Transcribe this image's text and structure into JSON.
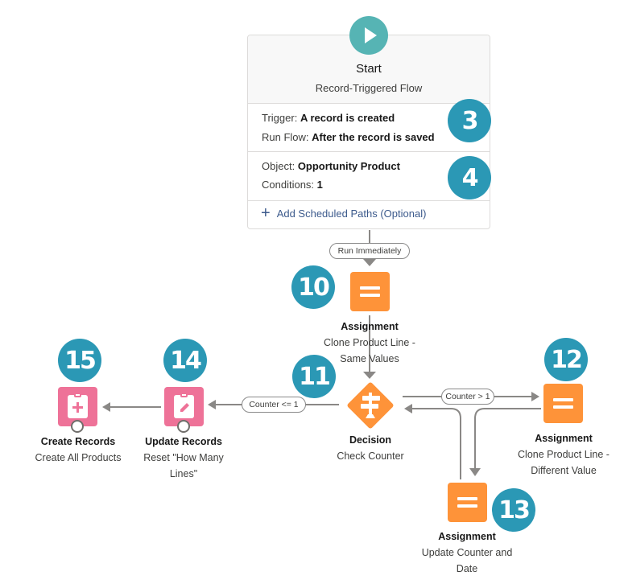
{
  "start": {
    "icon": "play-icon",
    "title": "Start",
    "subtitle": "Record-Triggered Flow",
    "trigger_label": "Trigger:",
    "trigger_value": "A record is created",
    "run_flow_label": "Run Flow:",
    "run_flow_value": "After the record is saved",
    "object_label": "Object:",
    "object_value": "Opportunity Product",
    "conditions_label": "Conditions:",
    "conditions_value": "1",
    "add_paths_label": "Add Scheduled Paths (Optional)"
  },
  "badges": {
    "b3": "3",
    "b4": "4",
    "b10": "10",
    "b11": "11",
    "b12": "12",
    "b13": "13",
    "b14": "14",
    "b15": "15"
  },
  "connectors": {
    "run_immediately": "Run Immediately",
    "counter_le_1": "Counter <= 1",
    "counter_gt_1": "Counter > 1"
  },
  "nodes": {
    "assign_same": {
      "type": "Assignment",
      "name_line1": "Clone Product Line -",
      "name_line2": "Same Values",
      "icon": "equals-icon"
    },
    "decision": {
      "type": "Decision",
      "name": "Check Counter",
      "icon": "signpost-icon"
    },
    "assign_diff": {
      "type": "Assignment",
      "name_line1": "Clone Product Line -",
      "name_line2": "Different Value",
      "icon": "equals-icon"
    },
    "assign_counter": {
      "type": "Assignment",
      "name_line1": "Update Counter and",
      "name_line2": "Date",
      "icon": "equals-icon"
    },
    "update_records": {
      "type": "Update Records",
      "name_line1": "Reset \"How Many",
      "name_line2": "Lines\"",
      "icon": "clipboard-edit-icon"
    },
    "create_records": {
      "type": "Create Records",
      "name": "Create All Products",
      "icon": "clipboard-add-icon"
    }
  },
  "colors": {
    "badge": "#2b98b5",
    "start": "#56b4b4",
    "assignment": "#fe9339",
    "records": "#ee7298",
    "connector": "#8a8886"
  }
}
